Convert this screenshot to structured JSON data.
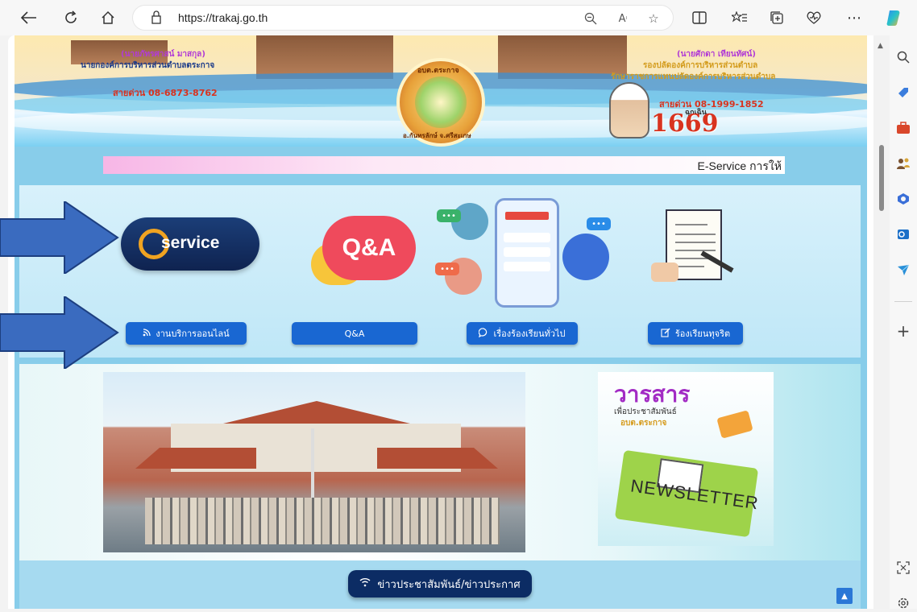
{
  "browser": {
    "url": "https://trakaj.go.th",
    "icons": [
      "back-icon",
      "refresh-icon",
      "home-icon",
      "site-info-icon",
      "zoom-out-icon",
      "read-aloud-icon",
      "favorite-icon",
      "split-screen-icon",
      "favorites-list-icon",
      "collections-icon",
      "performance-icon",
      "more-icon",
      "copilot-icon"
    ]
  },
  "sidebar": {
    "icons": [
      "search-icon",
      "tag-icon",
      "tools-icon",
      "people-icon",
      "office-icon",
      "outlook-icon",
      "send-icon",
      "add-icon",
      "screenshot-icon",
      "settings-icon"
    ]
  },
  "header": {
    "mayor_name": "(นายภัทรศาสน์ มาสกุล)",
    "mayor_title": "นายกองค์การบริหารส่วนตำบลตระกาจ",
    "hotline_left": "สายด่วน 08-6873-8762",
    "deputy_name": "(นายศักดา เทียนทัศน์)",
    "deputy_title_1": "รองปลัดองค์การบริหารส่วนตำบล",
    "deputy_title_2": "รักษาราชการแทนปลัดองค์การบริหารส่วนตำบล",
    "seal_text_top": "อบต.ตระกาจ",
    "seal_text_bottom": "อ.กันทรลักษ์ จ.ศรีสะเกษ",
    "hotline_right": "สายด่วน 08-1999-1852",
    "emergency_label": "ฉุกเฉิน",
    "emergency_number": "1669"
  },
  "ticker": {
    "text": "E-Service การให้"
  },
  "services": {
    "eservice_logo": "service",
    "qa_logo": "Q&A",
    "buttons": [
      {
        "label": "งานบริการออนไลน์",
        "icon": "rss-icon"
      },
      {
        "label": "Q&A",
        "icon": ""
      },
      {
        "label": "เรื่องร้องเรียนทั่วไป",
        "icon": "chat-icon"
      },
      {
        "label": "ร้องเรียนทุจริต",
        "icon": "edit-icon"
      }
    ]
  },
  "newsletter": {
    "title": "วารสาร",
    "subtitle": "เพื่อประชาสัมพันธ์",
    "org": "อบต.ตระกาจ",
    "word": "NEWSLETTER"
  },
  "news": {
    "button_label": "ข่าวประชาสัมพันธ์/ข่าวประกาศ",
    "button_icon": "wifi-icon"
  },
  "colors": {
    "accent_blue": "#1967d2",
    "navy": "#0c2c64",
    "band": "#88cdea",
    "arrow_blue": "#3a6bbf"
  }
}
